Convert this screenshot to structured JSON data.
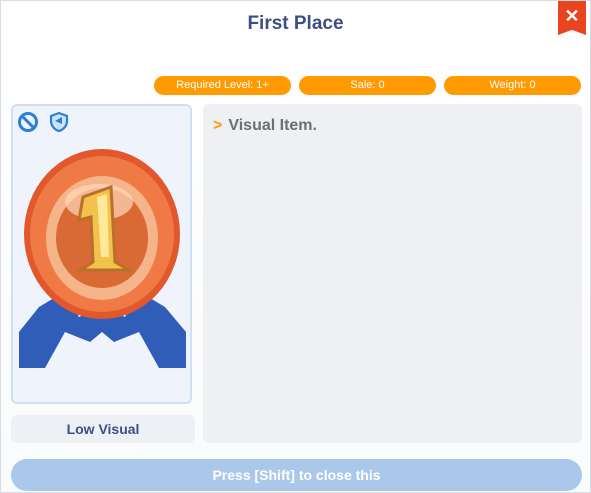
{
  "window": {
    "title": "First Place",
    "close_label": "✕"
  },
  "badges": [
    {
      "label": "Required Level: 1+"
    },
    {
      "label": "Sale: 0"
    },
    {
      "label": "Weight: 0"
    }
  ],
  "item": {
    "icons": [
      "prohibited-icon",
      "shield-icon"
    ],
    "caption": "Low Visual",
    "image": "first-place-medal-icon"
  },
  "description": {
    "arrow": ">",
    "text": "Visual Item."
  },
  "footer": {
    "close_hint": "Press [Shift] to close this"
  },
  "colors": {
    "accent": "#ff9a00",
    "title": "#3b4f86",
    "close": "#e8441f",
    "footer": "#a9c8ea"
  }
}
